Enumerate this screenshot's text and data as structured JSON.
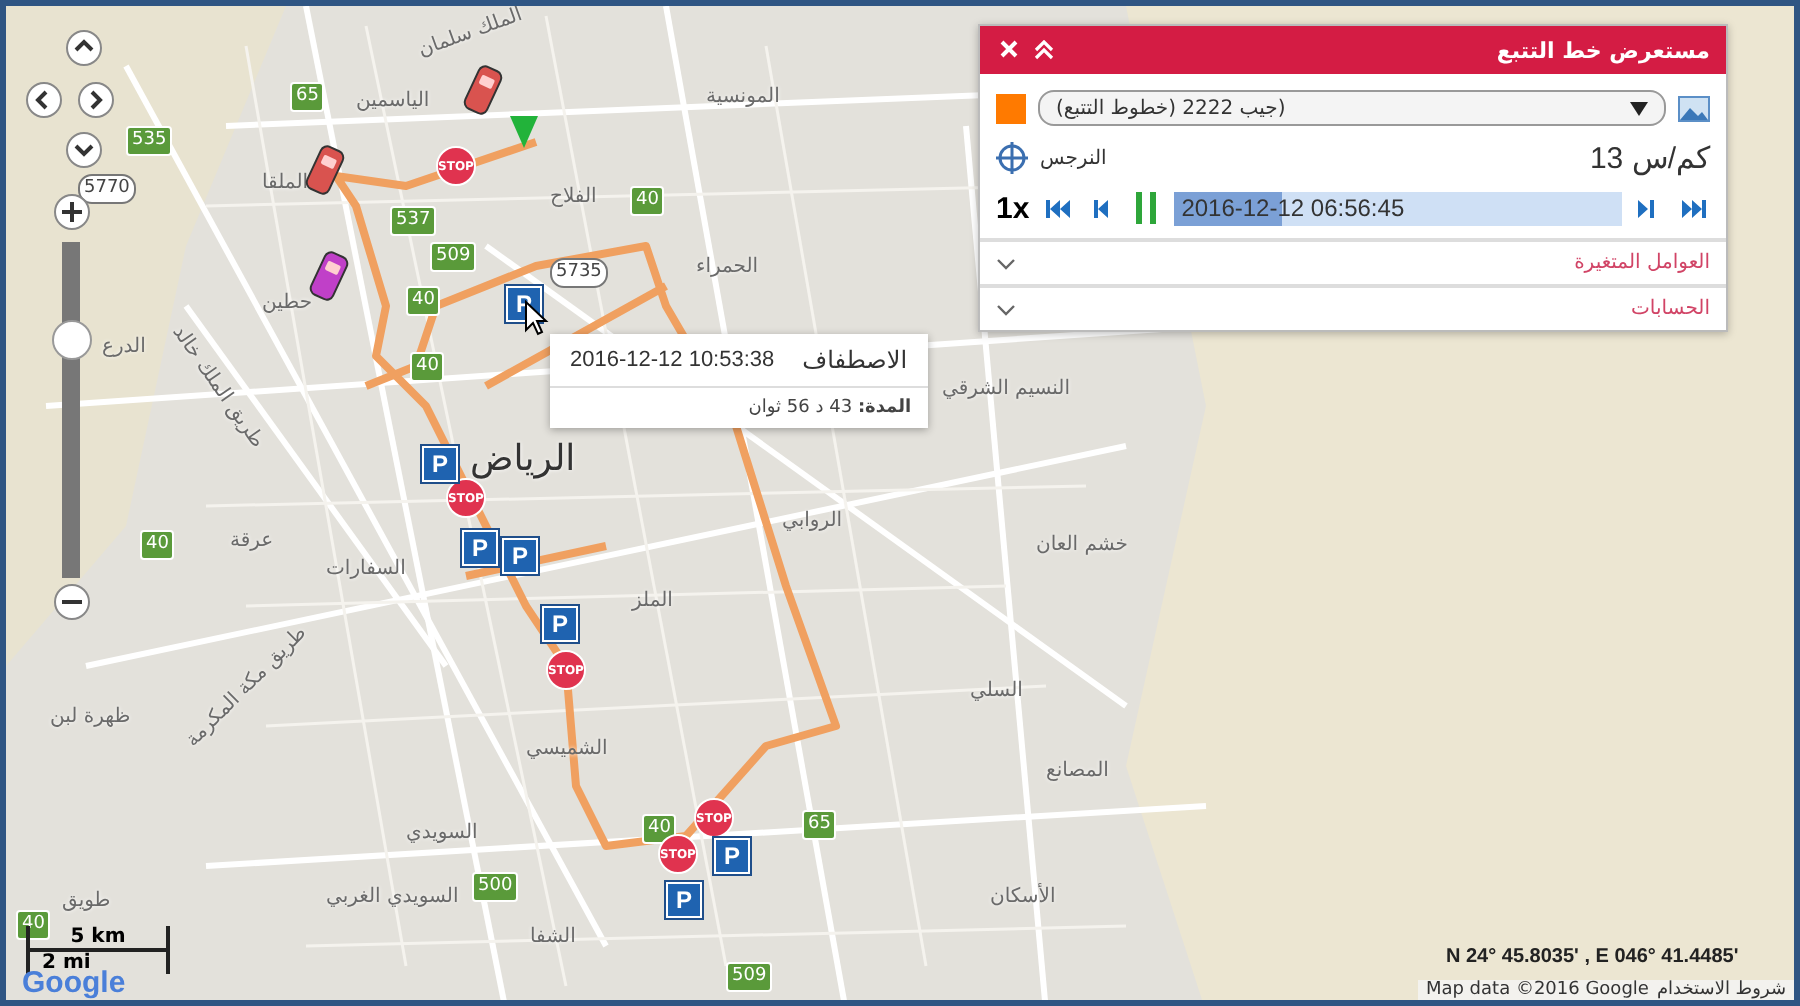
{
  "map": {
    "labels": [
      "الملك سلمان",
      "الياسمين",
      "الملقا",
      "حطين",
      "الدرع",
      "طريق الملك خالد",
      "الرياض",
      "عرقة",
      "السفارات",
      "طريق مكة المكرمة",
      "ظهرة لبن",
      "السويدي الغربي",
      "طويق",
      "الشفا",
      "الأسكان",
      "المصانع",
      "السلي",
      "خشم العان",
      "الروابي",
      "النسيم الشرقي",
      "المونسية",
      "الفلاح",
      "الحمراء",
      "الملز",
      "الشميسي",
      "السويدي"
    ],
    "road_badges": [
      "65",
      "535",
      "5770",
      "537",
      "509",
      "40",
      "5735",
      "40",
      "40",
      "40",
      "500",
      "509",
      "65",
      "40",
      "40"
    ],
    "markers": [
      {
        "kind": "car",
        "color": "#d9534f"
      },
      {
        "kind": "car",
        "color": "#d9534f"
      },
      {
        "kind": "car",
        "color": "#c040c8"
      },
      {
        "kind": "arrow",
        "color": "#22b33a"
      },
      {
        "kind": "stop",
        "label": "STOP"
      },
      {
        "kind": "stop",
        "label": "STOP"
      },
      {
        "kind": "stop",
        "label": "STOP"
      },
      {
        "kind": "stop",
        "label": "STOP"
      },
      {
        "kind": "stop",
        "label": "STOP"
      },
      {
        "kind": "parking",
        "label": "P"
      },
      {
        "kind": "parking",
        "label": "P"
      },
      {
        "kind": "parking",
        "label": "P"
      },
      {
        "kind": "parking",
        "label": "P"
      },
      {
        "kind": "parking",
        "label": "P"
      },
      {
        "kind": "parking",
        "label": "P"
      },
      {
        "kind": "parking",
        "label": "P"
      }
    ],
    "zoom": {
      "level": 0.73
    },
    "tooltip": {
      "time": "2016-12-12 10:53:38",
      "event": "الاصطفاف",
      "duration": "**المدة:** 43 د 56 ثوان"
    },
    "scale": {
      "metric": "5 km",
      "imperial": "2 mi"
    },
    "logo": "Google",
    "coordinates": "N 24° 45.8035' , E 046° 41.4485'",
    "attribution": "Map data ©2016 Google",
    "terms": "شروط الاستخدام"
  },
  "panel": {
    "title": "مستعرض خط التتبع",
    "color": "#ff7a00",
    "vehicle": "(جيب 2222 (خطوط التتبع)",
    "speed": "13 كم/س",
    "location": "النرجس",
    "rate": "1x",
    "playing": true,
    "progress": {
      "level": 0.24,
      "time": "2016-12-12 06:56:45"
    },
    "sections": [
      {
        "label": "العوامل المتغيرة",
        "expanded": false
      },
      {
        "label": "الحسابات",
        "expanded": false
      }
    ]
  }
}
